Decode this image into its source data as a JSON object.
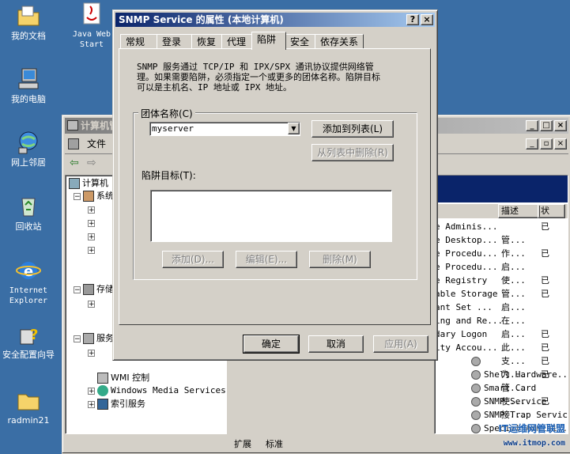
{
  "desktop": {
    "icons": [
      {
        "label": "我的文档"
      },
      {
        "label": "Java Web Start"
      },
      {
        "label": "我的电脑"
      },
      {
        "label": "网上邻居"
      },
      {
        "label": "回收站"
      },
      {
        "label": "Internet Explorer"
      },
      {
        "label": "安全配置向导"
      },
      {
        "label": "radmin21"
      }
    ]
  },
  "mmc": {
    "title": "计算机管",
    "menu_file": "文件",
    "tree": {
      "root": "计算机",
      "system": "系统",
      "storage": "存储",
      "services": "服务",
      "wmi": "WMI 控制",
      "wms": "Windows Media Services",
      "index": "索引服务"
    },
    "columns": {
      "desc": "描述",
      "status": "状"
    },
    "services": [
      {
        "name": "e Adminis...",
        "desc": "",
        "status": "已"
      },
      {
        "name": "e Desktop...",
        "desc": "管...",
        "status": ""
      },
      {
        "name": "e Procedu...",
        "desc": "作...",
        "status": "已"
      },
      {
        "name": "e Procedu...",
        "desc": "启...",
        "status": ""
      },
      {
        "name": "e Registry",
        "desc": "使...",
        "status": "已"
      },
      {
        "name": "able Storage",
        "desc": "管...",
        "status": "已"
      },
      {
        "name": "ant Set ...",
        "desc": "启...",
        "status": ""
      },
      {
        "name": "ing and Re...",
        "desc": "在...",
        "status": ""
      },
      {
        "name": "dary Logon",
        "desc": "启...",
        "status": "已"
      },
      {
        "name": "ity Accou...",
        "desc": "此...",
        "status": "已"
      },
      {
        "name": "",
        "desc": "支...",
        "status": "已"
      },
      {
        "name": "Shell Hardware...",
        "desc": "为...",
        "status": "已"
      },
      {
        "name": "Smart Card",
        "desc": "管...",
        "status": ""
      },
      {
        "name": "SNMP Service",
        "desc": "使...",
        "status": "已"
      },
      {
        "name": "SNMP Trap Service",
        "desc": "接...",
        "status": ""
      },
      {
        "name": "Special Admini...",
        "desc": "",
        "status": ""
      }
    ],
    "bottom_tabs": {
      "extended": "扩展",
      "standard": "标准"
    },
    "watermark": "IT运维网管联盟",
    "watermark_url": "www.itmop.com"
  },
  "dialog": {
    "title": "SNMP Service 的属性 (本地计算机)",
    "help_btn": "?",
    "close_btn": "×",
    "tabs": [
      "常规",
      "登录",
      "恢复",
      "代理",
      "陷阱",
      "安全",
      "依存关系"
    ],
    "active_tab": "陷阱",
    "description": "SNMP 服务通过 TCP/IP 和 IPX/SPX 通讯协议提供网络管理。如果需要陷阱，必须指定一个或更多的团体名称。陷阱目标可以是主机名、IP 地址或 IPX 地址。",
    "community_group_label": "团体名称(C)",
    "community_value": "myserver",
    "add_to_list": "添加到列表(L)",
    "remove_from_list": "从列表中删除(R)",
    "trap_dest_label": "陷阱目标(T):",
    "add_btn": "添加(D)...",
    "edit_btn": "编辑(E)...",
    "remove_btn": "删除(M)",
    "ok": "确定",
    "cancel": "取消",
    "apply": "应用(A)"
  }
}
